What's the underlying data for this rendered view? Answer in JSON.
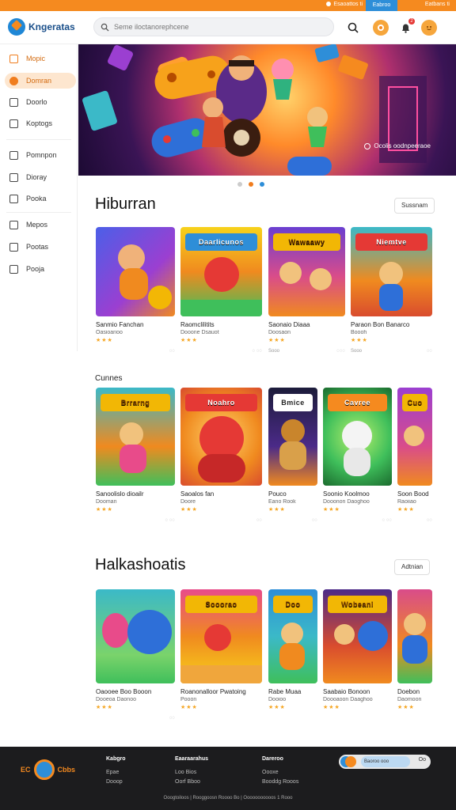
{
  "topbar": {
    "promo": "Esaoattos ti",
    "blue": "Eabroo",
    "last": "Eatbans ti"
  },
  "header": {
    "brand": "Kngeratas",
    "search_placeholder": "Seme iloctanorephcene",
    "notif_count": "2"
  },
  "sidebar": {
    "items": [
      {
        "label": "Mopic"
      },
      {
        "label": "Domran"
      },
      {
        "label": "Doorlo"
      },
      {
        "label": "Koptogs"
      },
      {
        "label": "Pomnpon"
      },
      {
        "label": "Dioray"
      },
      {
        "label": "Pooka"
      },
      {
        "label": "Mepos"
      },
      {
        "label": "Pootas"
      },
      {
        "label": "Pooja"
      }
    ]
  },
  "hero": {
    "caption": "Ocolis oodnpeeraoe"
  },
  "sections": [
    {
      "title": "Hiburran",
      "see_all": "Sussnam",
      "cards": [
        {
          "art": "",
          "name": "Sanmio Fanchan",
          "sub": "Oasioarioo",
          "stars": "★★★",
          "meta_l": "",
          "meta_r": "◌◌"
        },
        {
          "art": "Daarlicunos",
          "name": "Raomclilitits",
          "sub": "Dooone Dsauot",
          "stars": "★★★",
          "meta_l": "",
          "meta_r": "◌ ◌◌"
        },
        {
          "art": "Wawaawy",
          "name": "Saonaio Diaaa",
          "sub": "Doosaon",
          "stars": "★★★",
          "meta_l": "Sooo",
          "meta_r": "◌◌◌"
        },
        {
          "art": "Niemtve",
          "name": "Paraon Bon Banarco",
          "sub": "Boooh",
          "stars": "★★★",
          "meta_l": "Sooo",
          "meta_r": "◌◌"
        }
      ]
    },
    {
      "title": "Cunnes",
      "see_all": "",
      "cards": [
        {
          "art": "Brrarng",
          "name": "Sanoolislo dioailr",
          "sub": "Dooman",
          "stars": "★★★",
          "meta_l": "",
          "meta_r": "◌ ◌◌"
        },
        {
          "art": "Noahro",
          "name": "Saoalos fan",
          "sub": "Doore",
          "stars": "★★★",
          "meta_l": "",
          "meta_r": "◌◌"
        },
        {
          "art": "Bmice",
          "name": "Pouco",
          "sub": "Eano Rook",
          "stars": "★★★",
          "meta_l": "",
          "meta_r": "◌◌"
        },
        {
          "art": "Cavree",
          "name": "Soonio Koolmoo",
          "sub": "Dooonon Daoghoo",
          "stars": "★★★",
          "meta_l": "",
          "meta_r": "◌ ◌◌"
        },
        {
          "art": "Cuo",
          "name": "Soon Bood",
          "sub": "Raoiiao",
          "stars": "★★★",
          "meta_l": "",
          "meta_r": "◌◌"
        }
      ]
    },
    {
      "title": "Halkashoatis",
      "see_all": "Adtnian",
      "cards": [
        {
          "art": "",
          "name": "Oaooee Boo Booon",
          "sub": "Dooeoa Daonoo",
          "stars": "★★★",
          "meta_l": "",
          "meta_r": "◌◌"
        },
        {
          "art": "Sooorao",
          "name": "Roanonalloor Pwatoing",
          "sub": "Pooon",
          "stars": "★★★",
          "meta_l": "",
          "meta_r": ""
        },
        {
          "art": "Doo",
          "name": "Rabe Muaa",
          "sub": "Dooioo",
          "stars": "★★★",
          "meta_l": "",
          "meta_r": ""
        },
        {
          "art": "Wobeani",
          "name": "Saabaio Bonoon",
          "sub": "Doooaoon Daaghoo",
          "stars": "★★★",
          "meta_l": "",
          "meta_r": ""
        },
        {
          "art": "",
          "name": "Doebon",
          "sub": "Daomoon",
          "stars": "★★★",
          "meta_l": "",
          "meta_r": ""
        }
      ]
    }
  ],
  "footer": {
    "logo_left": "EC",
    "logo_right": "Cbbs",
    "col1": {
      "head": "Kabgro",
      "links": [
        "Epae",
        "Dooop"
      ]
    },
    "col2": {
      "head": "Eaaraarahus",
      "links": [
        "Loo Bios",
        "Oorf Bboo"
      ]
    },
    "col3": {
      "head": "Dareroo",
      "links": [
        "Oooxe",
        "Booddg Rooos"
      ]
    },
    "subscribe_placeholder": "Baoroo ooo",
    "subscribe_go": "Oo",
    "copyright": "Ooogtoiloos | Rooggoosn Roooo Bo | Ooooooooooos 1 Rooo"
  },
  "colors": {
    "brand_orange": "#f58a1f",
    "brand_blue": "#2e8ed8",
    "footer_bg": "#1c1c1e"
  }
}
